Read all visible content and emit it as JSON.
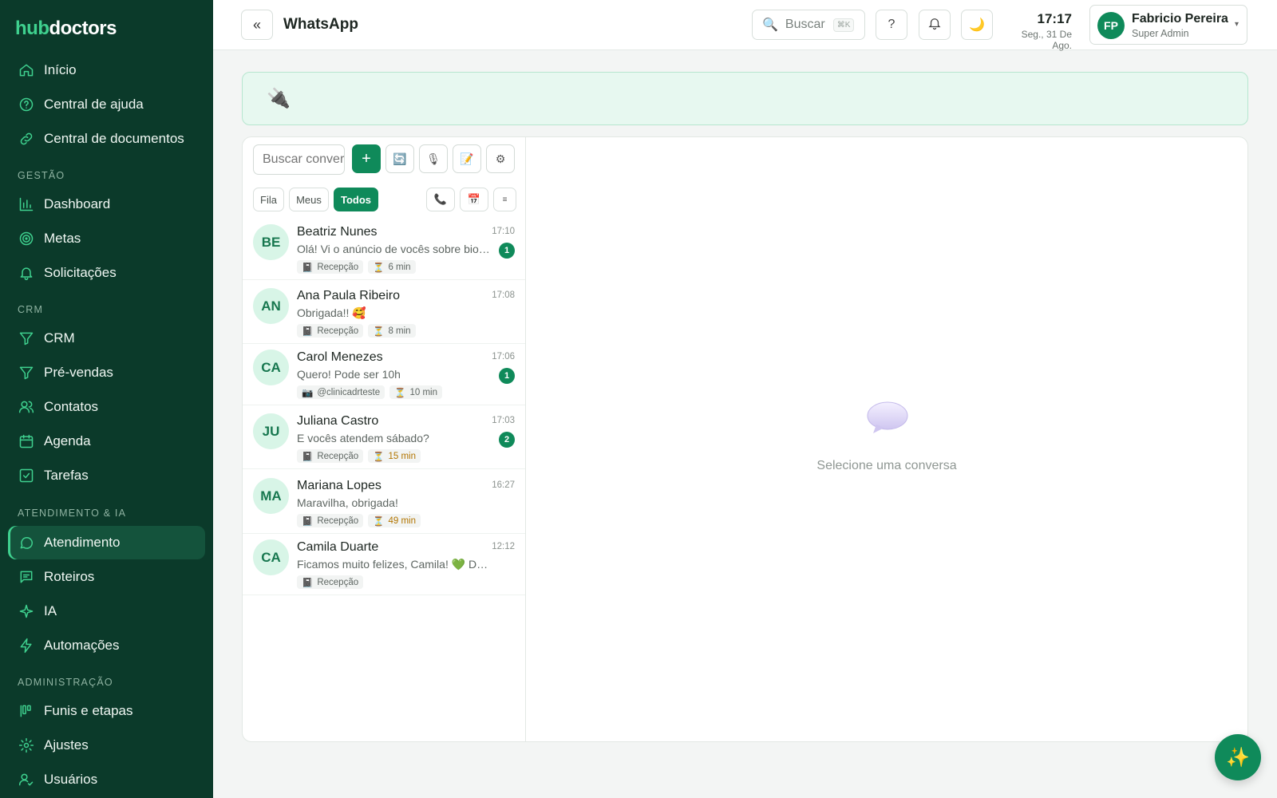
{
  "brand": {
    "part1": "hub",
    "part2": "doctors"
  },
  "sidebar": {
    "top_items": [
      {
        "label": "Início",
        "icon": "home-icon"
      },
      {
        "label": "Central de ajuda",
        "icon": "help-circle-icon"
      },
      {
        "label": "Central de documentos",
        "icon": "link-icon"
      }
    ],
    "sections": [
      {
        "title": "GESTÃO",
        "items": [
          {
            "label": "Dashboard",
            "icon": "bar-chart-icon"
          },
          {
            "label": "Metas",
            "icon": "target-icon"
          },
          {
            "label": "Solicitações",
            "icon": "bell-icon"
          }
        ]
      },
      {
        "title": "CRM",
        "items": [
          {
            "label": "CRM",
            "icon": "funnel-icon"
          },
          {
            "label": "Pré-vendas",
            "icon": "funnel-icon"
          },
          {
            "label": "Contatos",
            "icon": "users-icon"
          },
          {
            "label": "Agenda",
            "icon": "calendar-icon"
          },
          {
            "label": "Tarefas",
            "icon": "checkbox-icon"
          }
        ]
      },
      {
        "title": "ATENDIMENTO & IA",
        "items": [
          {
            "label": "Atendimento",
            "icon": "chat-icon",
            "active": true
          },
          {
            "label": "Roteiros",
            "icon": "message-square-icon"
          },
          {
            "label": "IA",
            "icon": "sparkle-icon"
          },
          {
            "label": "Automações",
            "icon": "zap-icon"
          }
        ]
      },
      {
        "title": "ADMINISTRAÇÃO",
        "items": [
          {
            "label": "Funis e etapas",
            "icon": "kanban-icon"
          },
          {
            "label": "Ajustes",
            "icon": "gear-icon"
          },
          {
            "label": "Usuários",
            "icon": "user-check-icon"
          }
        ]
      }
    ]
  },
  "header": {
    "title": "WhatsApp",
    "collapse_icon": "«",
    "search_label": "Buscar",
    "search_shortcut": "⌘K",
    "help_label": "?",
    "time": "17:17",
    "date": "Seg., 31 De Ago.",
    "user": {
      "initials": "FP",
      "name": "Fabricio Pereira",
      "role": "Super Admin"
    }
  },
  "banner": {
    "icon": "plug-icon"
  },
  "chat_list": {
    "search_placeholder": "Buscar conversa",
    "add_label": "+",
    "tabs": [
      "Fila",
      "Meus",
      "Todos"
    ],
    "active_tab": "Todos",
    "conversations": [
      {
        "initials": "BE",
        "name": "Beatriz Nunes",
        "time": "17:10",
        "message": "Olá! Vi o anúncio de vocês sobre bioestimulador",
        "unread": "1",
        "tag": "Recepção",
        "wait": "6 min",
        "wait_warn": false
      },
      {
        "initials": "AN",
        "name": "Ana Paula Ribeiro",
        "time": "17:08",
        "message": "Obrigada!! 🥰",
        "unread": "",
        "tag": "Recepção",
        "wait": "8 min",
        "wait_warn": false
      },
      {
        "initials": "CA",
        "name": "Carol Menezes",
        "time": "17:06",
        "message": "Quero! Pode ser 10h",
        "unread": "1",
        "tag": "@clinicadrteste",
        "wait": "10 min",
        "wait_warn": false
      },
      {
        "initials": "JU",
        "name": "Juliana Castro",
        "time": "17:03",
        "message": "E vocês atendem sábado?",
        "unread": "2",
        "tag": "Recepção",
        "wait": "15 min",
        "wait_warn": true
      },
      {
        "initials": "MA",
        "name": "Mariana Lopes",
        "time": "16:27",
        "message": "Maravilha, obrigada!",
        "unread": "",
        "tag": "Recepção",
        "wait": "49 min",
        "wait_warn": true
      },
      {
        "initials": "CA",
        "name": "Camila Duarte",
        "time": "12:12",
        "message": "Ficamos muito felizes, Camila! 💚 Daqui ...",
        "unread": "",
        "tag": "Recepção",
        "wait": "",
        "wait_warn": false
      }
    ]
  },
  "empty_state": {
    "text": "Selecione uma conversa"
  },
  "colors": {
    "sidebar_bg": "#0b3a2a",
    "accent": "#0f8a5a",
    "accent_light": "#3fd18f"
  }
}
